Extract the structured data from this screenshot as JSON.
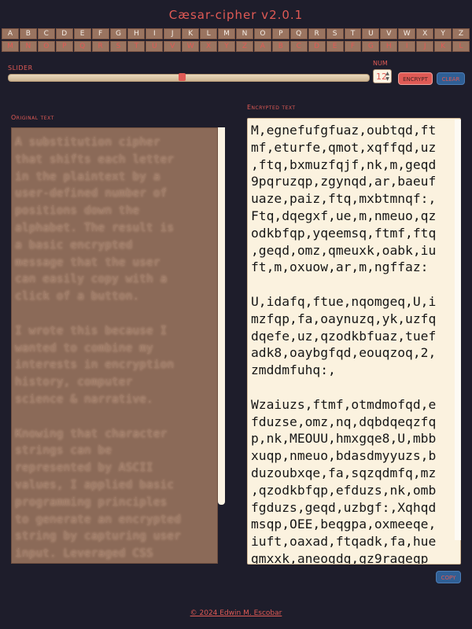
{
  "app": {
    "title": "Cæsar-cipher v2.0.1"
  },
  "alphabet": {
    "plain": [
      "A",
      "B",
      "C",
      "D",
      "E",
      "F",
      "G",
      "H",
      "I",
      "J",
      "K",
      "L",
      "M",
      "N",
      "O",
      "P",
      "Q",
      "R",
      "S",
      "T",
      "U",
      "V",
      "W",
      "X",
      "Y",
      "Z"
    ],
    "cipher": [
      "M",
      "N",
      "O",
      "P",
      "Q",
      "R",
      "S",
      "T",
      "U",
      "V",
      "W",
      "X",
      "Y",
      "Z",
      "A",
      "B",
      "C",
      "D",
      "E",
      "F",
      "G",
      "H",
      "I",
      "J",
      "K",
      "L"
    ]
  },
  "controls": {
    "slider_label": "Slider",
    "slider_value": 12,
    "slider_max": 25,
    "num_label": "Num",
    "num_value": "12",
    "encrypt_label": "encrypt",
    "clear_label": "clear",
    "copy_label": "copy"
  },
  "original": {
    "label": "Original text",
    "text": "A substitution cipher\nthat shifts each letter\nin the plaintext by a\nuser-defined number of\npositions down the\nalphabet. The result is\na basic encrypted\nmessage that the user\ncan easily copy with a\nclick of a button.\n\nI wrote this because I\nwanted to combine my\ninterests in encryption\nhistory, computer\nscience & narrative.\n\nKnowing that character\nstrings can be\nrepresented by ASCII\nvalues, I applied basic\nprogramming principles\nto generate an encrypted\nstring by capturing user\ninput. Leveraged CSS"
  },
  "encrypted": {
    "label": "Encrypted text",
    "text": "M,egnefufgfuaz,oubtqd,ft\nmf,eturfe,qmot,xqffqd,uz\n,ftq,bxmuzfqjf,nk,m,geqd\n9pqruzqp,zgynqd,ar,baeuf\nuaze,paiz,ftq,mxbtmnqf:,\nFtq,dqegxf,ue,m,nmeuo,qz\nodkbfqp,yqeemsq,ftmf,ftq\n,geqd,omz,qmeuxk,oabk,iu\nft,m,oxuow,ar,m,ngffaz:\n\nU,idafq,ftue,nqomgeq,U,i\nmzfqp,fa,oaynuzq,yk,uzfq\ndqefe,uz,qzodkbfuaz,tuef\nadk8,oaybgfqd,eouqzoq,2,\nzmddmfuhq:,\n\nWzaiuzs,ftmf,otmdmofqd,e\nfduzse,omz,nq,dqbdqeqzfq\np,nk,MEOUU,hmxgqe8,U,mbb\nxuqp,nmeuo,bdasdmyyuzs,b\nduzoubxqe,fa,sqzqdmfq,mz\n,qzodkbfqp,efduzs,nk,omb\nfgduzs,geqd,uzbgf:,Xqhqd\nmsqp,OEE,beqgpa,oxmeeqe,\niuft,oaxad,ftqadk,fa,hue\ngmxxk,aneogdq,gz9raqeqp"
  },
  "footer": {
    "text": "© 2024 Edwin M. Escobar"
  },
  "colors": {
    "background": "#1e1d2b",
    "accent": "#e05a55",
    "tile": "#9a7460",
    "paper": "#fbf2df",
    "button_blue": "#2f5f95"
  }
}
